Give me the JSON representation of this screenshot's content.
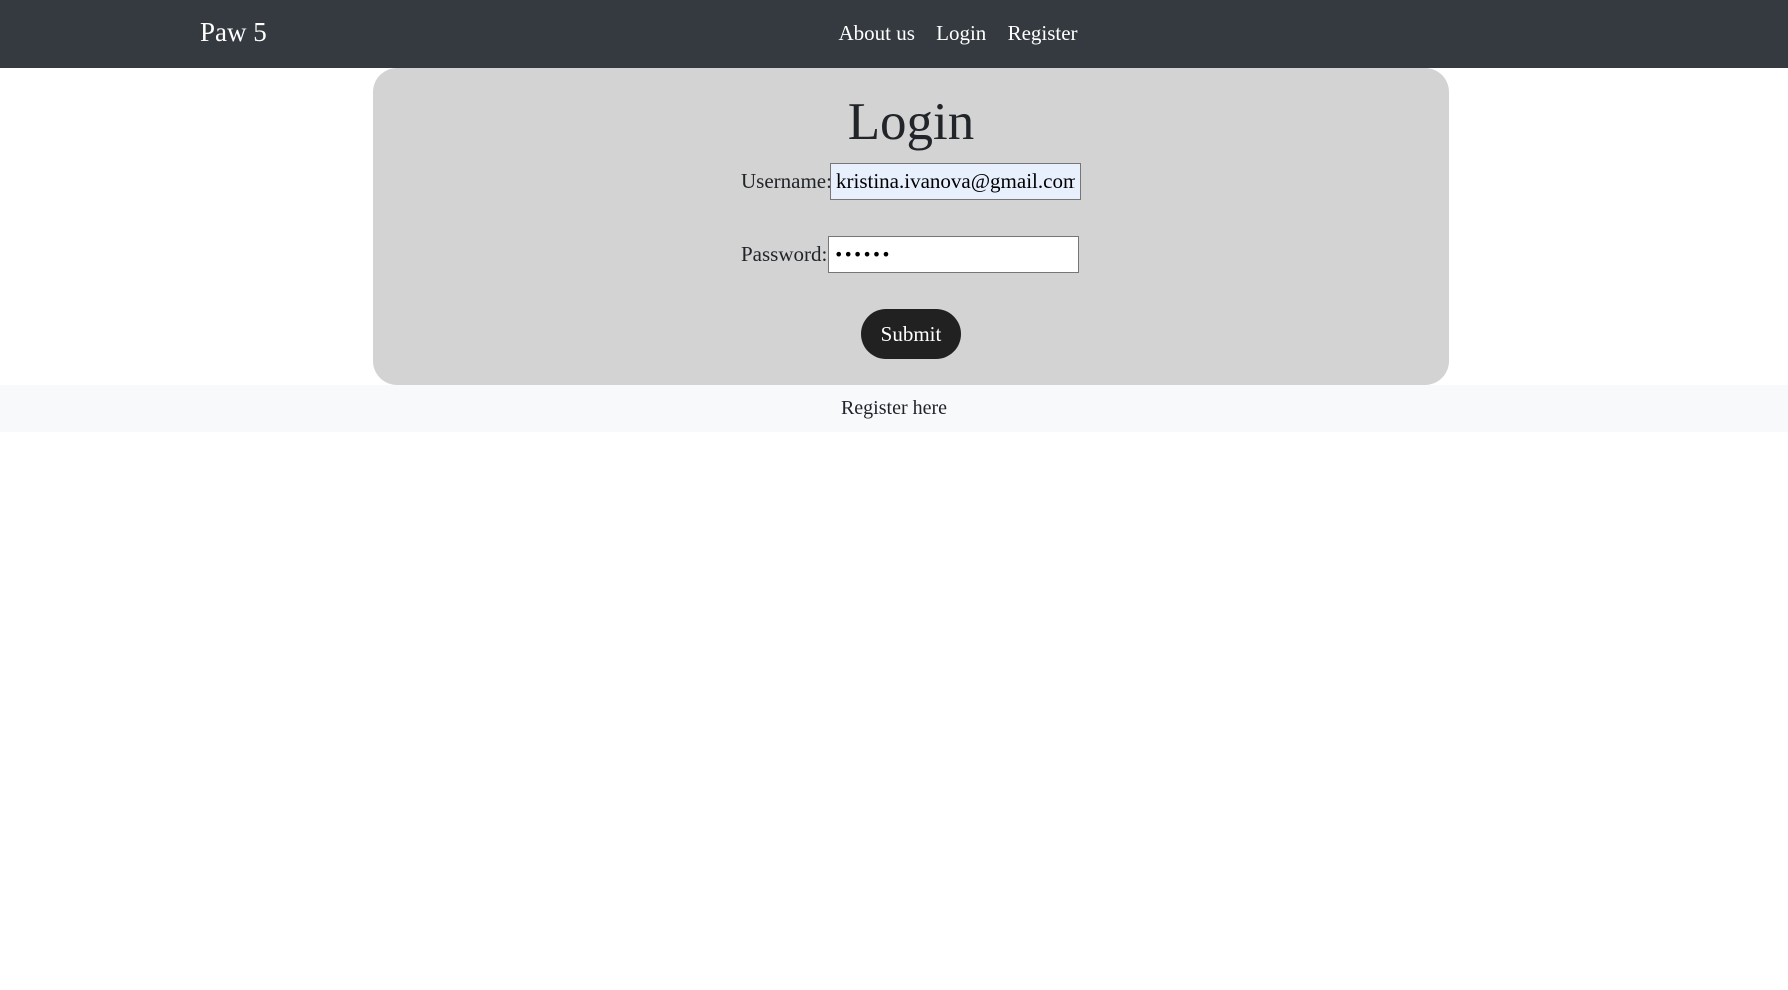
{
  "navbar": {
    "brand": "Paw 5",
    "links": [
      "About us",
      "Login",
      "Register"
    ]
  },
  "login_form": {
    "title": "Login",
    "username_label": "Username:",
    "username_value": "kristina.ivanova@gmail.com",
    "password_label": "Password:",
    "password_value": "••••••",
    "submit_label": "Submit"
  },
  "footer": {
    "register_link": "Register here"
  },
  "colors": {
    "navbar_bg": "#343a40",
    "card_bg": "#d3d3d3",
    "button_bg": "#212121",
    "footer_bg": "#f8f9fa",
    "autofill_bg": "#e8f0fe"
  }
}
